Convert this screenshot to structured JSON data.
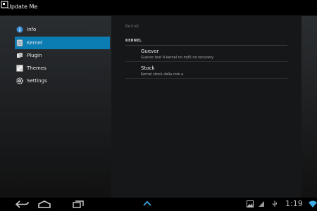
{
  "app": {
    "title": "Update Me"
  },
  "sidebar": {
    "items": [
      {
        "label": "Info",
        "icon": "info-icon",
        "active": false
      },
      {
        "label": "Kernel",
        "icon": "kernel-icon",
        "active": true
      },
      {
        "label": "Plugin",
        "icon": "plugin-icon",
        "active": false
      },
      {
        "label": "Themes",
        "icon": "themes-icon",
        "active": false
      },
      {
        "label": "Settings",
        "icon": "settings-icon",
        "active": false
      }
    ]
  },
  "content": {
    "header": "Kernel",
    "section": "KERNEL",
    "items": [
      {
        "title": "Guevor",
        "summary": "Guevor test 4 kernel no md5 no recovery"
      },
      {
        "title": "Stock",
        "summary": "Kernel stock della rom a"
      }
    ]
  },
  "status_bar": {
    "time": "1:19"
  },
  "colors": {
    "accent": "#0b7db3"
  }
}
